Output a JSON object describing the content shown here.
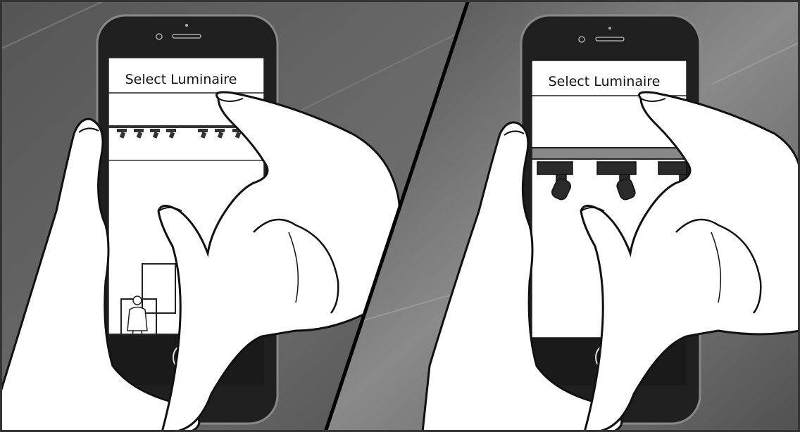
{
  "panels": [
    {
      "screen_title": "Select Luminaire",
      "view": "zoomed-out"
    },
    {
      "screen_title": "Select Luminaire",
      "view": "zoomed-in"
    }
  ],
  "colors": {
    "background_dark": "#4a4a4a",
    "background_light": "#7a7a7a",
    "phone_body": "#2a2a2a",
    "screen": "#ffffff",
    "skin": "#ffffff",
    "ink": "#1a1a1a"
  }
}
